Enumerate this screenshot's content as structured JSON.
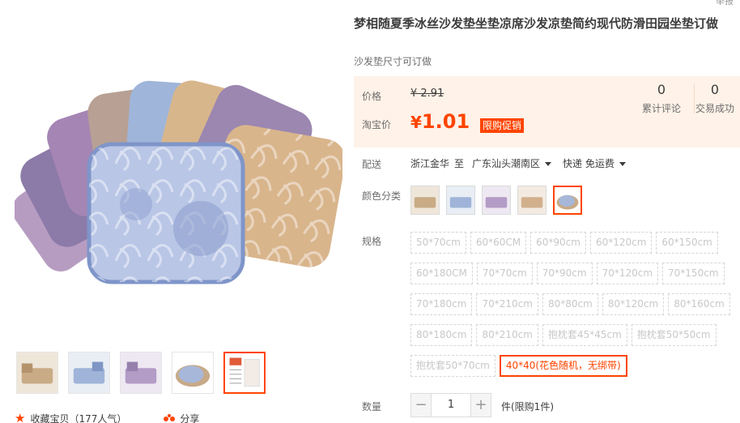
{
  "header": {
    "top_link": "举报"
  },
  "product": {
    "title": "梦相随夏季冰丝沙发垫坐垫凉席沙发凉垫简约现代防滑田园坐垫订做",
    "subtitle": "沙发垫尺寸可订做"
  },
  "price": {
    "price_label": "价格",
    "old_price": "¥ 2.91",
    "taobao_label": "淘宝价",
    "currency": "¥",
    "new_price": "1.01",
    "promo_tag": "限购促销"
  },
  "stats": {
    "reviews_count": "0",
    "reviews_label": "累计评论",
    "sales_count": "0",
    "sales_label": "交易成功"
  },
  "shipping": {
    "label": "配送",
    "origin": "浙江金华",
    "to": "至",
    "destination": "广东汕头潮南区",
    "method": "快递 免运费"
  },
  "color": {
    "label": "颜色分类",
    "swatches": [
      "beige",
      "blue",
      "purple",
      "tan",
      "bundle"
    ]
  },
  "specs": {
    "label": "规格",
    "rows": [
      [
        "50*70cm",
        "60*60CM",
        "60*90cm",
        "60*120cm",
        "60*150cm"
      ],
      [
        "60*180CM",
        "70*70cm",
        "70*90cm",
        "70*120cm",
        "70*150cm"
      ],
      [
        "70*180cm",
        "70*210cm",
        "80*80cm",
        "80*120cm",
        "80*160cm"
      ],
      [
        "80*180cm",
        "80*210cm",
        "抱枕套45*45cm",
        "抱枕套50*50cm"
      ],
      [
        "抱枕套50*70cm",
        "40*40(花色随机，无绑带)"
      ]
    ],
    "selected": "40*40(花色随机，无绑带)"
  },
  "quantity": {
    "label": "数量",
    "minus": "−",
    "value": "1",
    "plus": "+",
    "note": "件(限购1件)"
  },
  "actions": {
    "favorite": "收藏宝贝（177人气）",
    "share": "分享"
  },
  "colors": {
    "accent": "#ff4400",
    "price_bg": "#fff2e8"
  }
}
